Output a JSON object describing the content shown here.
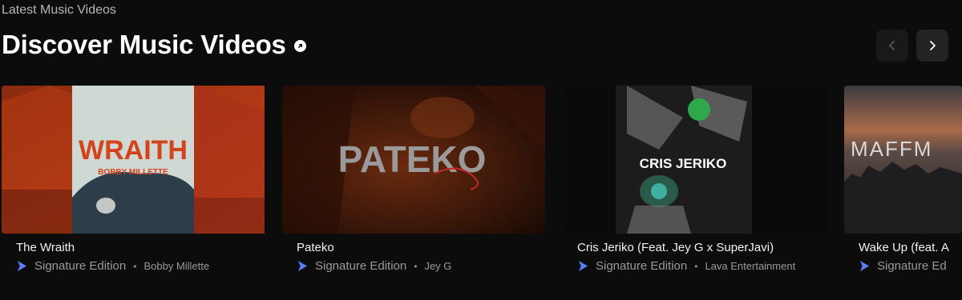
{
  "section": {
    "label": "Latest Music Videos",
    "title": "Discover Music Videos"
  },
  "icons": {
    "title_arrow": "arrow-circle-icon",
    "prev": "chevron-left-icon",
    "next": "chevron-right-icon",
    "signature": "signature-edition-icon"
  },
  "colors": {
    "accent": "#5b7cf6",
    "background": "#0c0c0c"
  },
  "cards": [
    {
      "title": "The Wraith",
      "badge": "Signature Edition",
      "artist": "Bobby Millette",
      "art": {
        "headline": "WRAITH",
        "sub": "BOBBY MILLETTE"
      }
    },
    {
      "title": "Pateko",
      "badge": "Signature Edition",
      "artist": "Jey G",
      "art": {
        "headline": "PATEKO"
      }
    },
    {
      "title": "Cris Jeriko (Feat. Jey G x SuperJavi)",
      "badge": "Signature Edition",
      "artist": "Lava Entertainment",
      "art": {
        "headline": "CRIS JERIKO"
      }
    },
    {
      "title": "Wake Up (feat. A",
      "badge": "Signature Ed",
      "art": {
        "headline": "MAFFM"
      }
    }
  ]
}
